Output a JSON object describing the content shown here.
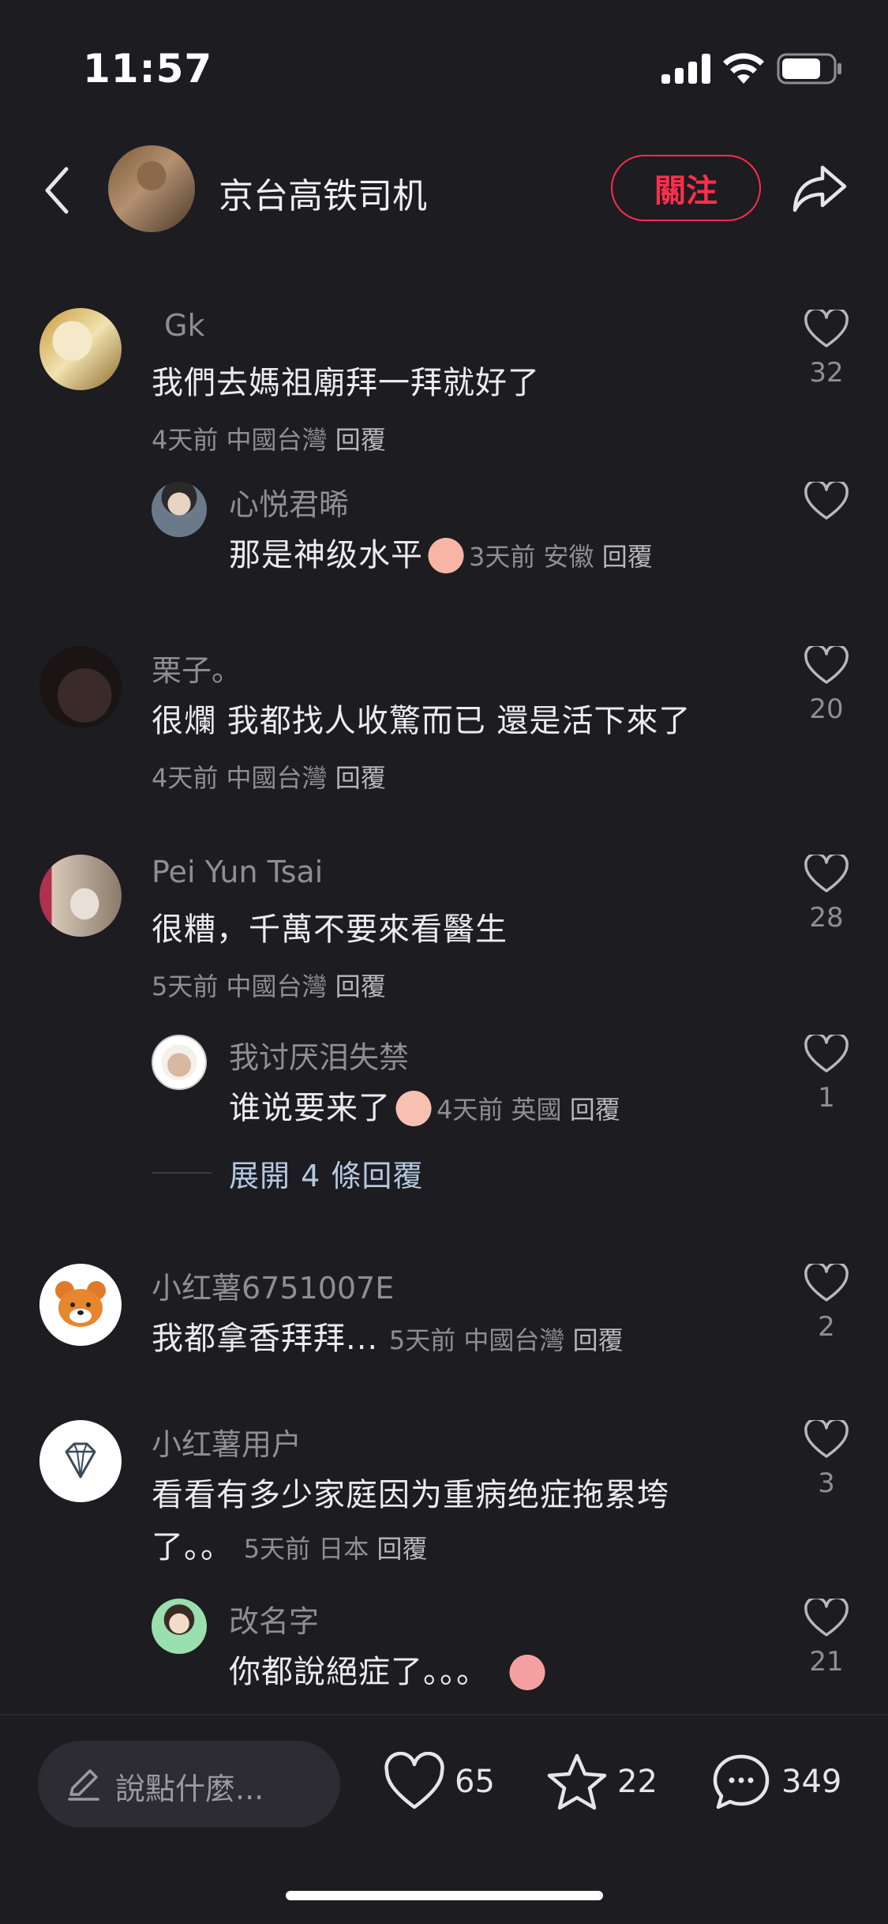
{
  "status": {
    "time": "11:57"
  },
  "header": {
    "author": "京台高铁司机",
    "follow_label": "關注"
  },
  "comments": [
    {
      "name": "Gk",
      "text": "我們去媽祖廟拜一拜就好了",
      "time": "4天前",
      "loc": "中國台灣",
      "reply": "回覆",
      "likes": "32"
    },
    {
      "name": "心悦君晞",
      "text": "那是神级水平",
      "time": "3天前",
      "loc": "安徽",
      "reply": "回覆",
      "likes": ""
    },
    {
      "name": "栗子。",
      "text": "很爛 我都找人收驚而已 還是活下來了",
      "time": "4天前",
      "loc": "中國台灣",
      "reply": "回覆",
      "likes": "20"
    },
    {
      "name": "Pei Yun Tsai",
      "text": "很糟，千萬不要來看醫生",
      "time": "5天前",
      "loc": "中國台灣",
      "reply": "回覆",
      "likes": "28"
    },
    {
      "name": "我讨厌泪失禁",
      "text": "谁说要来了",
      "time": "4天前",
      "loc": "英國",
      "reply": "回覆",
      "likes": "1"
    },
    {
      "name": "小红薯6751007E",
      "text": "我都拿香拜拜...",
      "time": "5天前",
      "loc": "中國台灣",
      "reply": "回覆",
      "likes": "2"
    },
    {
      "name": "小红薯用户",
      "text": "看看有多少家庭因为重病绝症拖累垮",
      "text2": "了。。",
      "time": "5天前",
      "loc": "日本",
      "reply": "回覆",
      "likes": "3"
    },
    {
      "name": "改名字",
      "text": "你都說絕症了。。。",
      "time": "",
      "loc": "",
      "reply": "",
      "likes": "21"
    }
  ],
  "expand_replies": "展開 4 條回覆",
  "bottom": {
    "placeholder": "說點什麼...",
    "likes": "65",
    "stars": "22",
    "comments": "349"
  },
  "colors": {
    "accent": "#ff2e4d",
    "background": "#1c1c21",
    "link": "#b5c8e0"
  },
  "icons": [
    "back-icon",
    "share-icon",
    "heart-icon",
    "star-icon",
    "comment-icon",
    "pencil-icon"
  ]
}
